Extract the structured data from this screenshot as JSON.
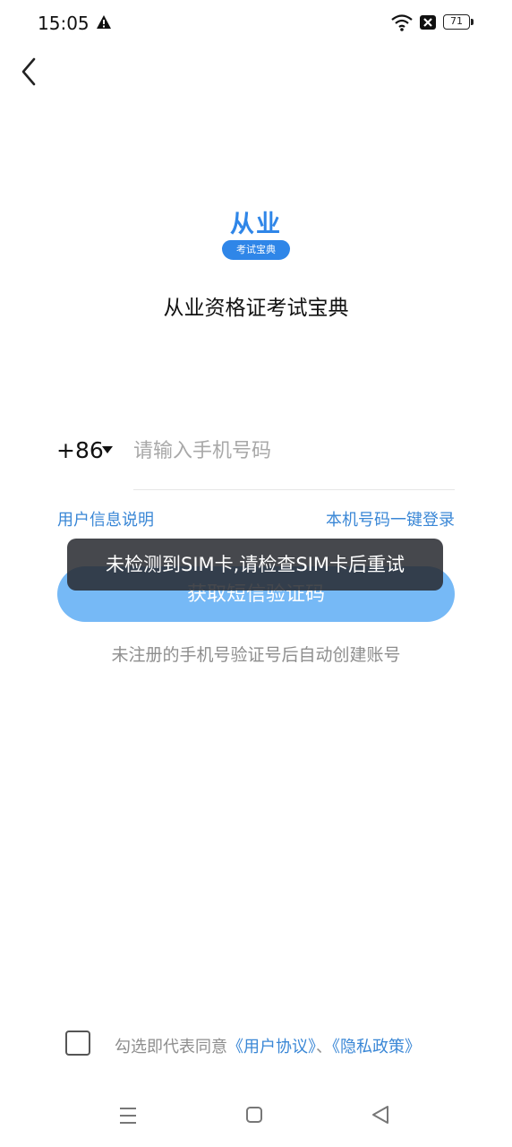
{
  "status_bar": {
    "time": "15:05",
    "battery": "71",
    "icons": [
      "warning-icon",
      "wifi-icon",
      "sim-missing-icon",
      "battery-icon"
    ]
  },
  "header": {
    "back_icon": "chevron-left-icon"
  },
  "logo": {
    "title": "从业",
    "ribbon": "考试宝典",
    "brand_color": "#2f86e8"
  },
  "app_name": "从业资格证考试宝典",
  "login": {
    "country_code": "+86",
    "phone_placeholder": "请输入手机号码",
    "phone_value": "",
    "user_info_link": "用户信息说明",
    "one_click_login_link": "本机号码一键登录",
    "sms_button": "获取短信验证码",
    "hint": "未注册的手机号验证号后自动创建账号"
  },
  "toast": {
    "message": "未检测到SIM卡,请检查SIM卡后重试"
  },
  "agreement": {
    "checked": false,
    "prefix": "勾选即代表同意",
    "user_agreement": "《用户协议》",
    "separator": "、",
    "privacy_policy": "《隐私政策》"
  },
  "colors": {
    "accent": "#3a87d6",
    "button_bg": "#76b9f6",
    "toast_bg": "#2a2c30"
  },
  "nav_bar": {
    "icons": [
      "menu-icon",
      "home-icon",
      "back-triangle-icon"
    ]
  }
}
